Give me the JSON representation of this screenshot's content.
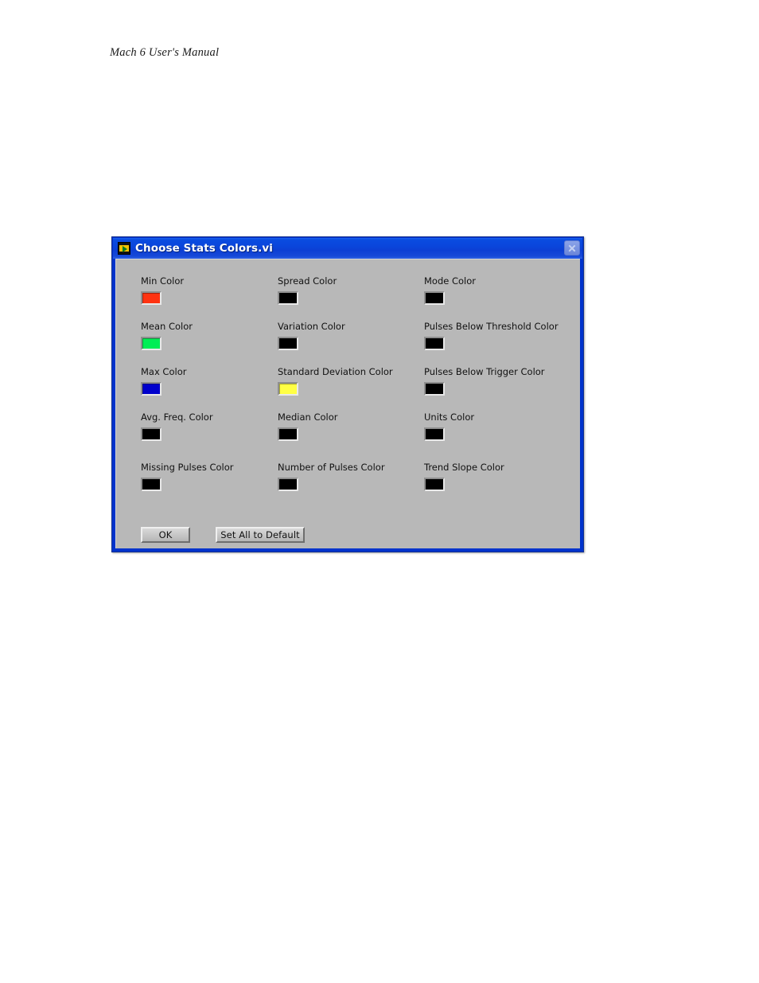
{
  "page": {
    "header": "Mach 6 User's Manual"
  },
  "dialog": {
    "title": "Choose Stats Colors.vi",
    "icon": "labview-vi-icon",
    "close_icon": "close-icon",
    "rows": [
      [
        {
          "label": "Min Color",
          "color": "#ff3311"
        },
        {
          "label": "Spread Color",
          "color": "#000000"
        },
        {
          "label": "Mode Color",
          "color": "#000000"
        }
      ],
      [
        {
          "label": "Mean Color",
          "color": "#00ee55"
        },
        {
          "label": "Variation Color",
          "color": "#000000"
        },
        {
          "label": "Pulses Below Threshold Color",
          "color": "#000000"
        }
      ],
      [
        {
          "label": "Max Color",
          "color": "#0000cc"
        },
        {
          "label": "Standard Deviation Color",
          "color": "#ffff44"
        },
        {
          "label": "Pulses Below Trigger Color",
          "color": "#000000"
        }
      ],
      [
        {
          "label": "Avg. Freq. Color",
          "color": "#000000"
        },
        {
          "label": "Median Color",
          "color": "#000000"
        },
        {
          "label": "Units Color",
          "color": "#000000"
        }
      ],
      [
        {
          "label": "Missing Pulses Color",
          "color": "#000000"
        },
        {
          "label": "Number of Pulses Color",
          "color": "#000000"
        },
        {
          "label": "Trend Slope Color",
          "color": "#000000"
        }
      ]
    ],
    "buttons": {
      "ok": "OK",
      "set_all_default": "Set All to Default"
    }
  }
}
